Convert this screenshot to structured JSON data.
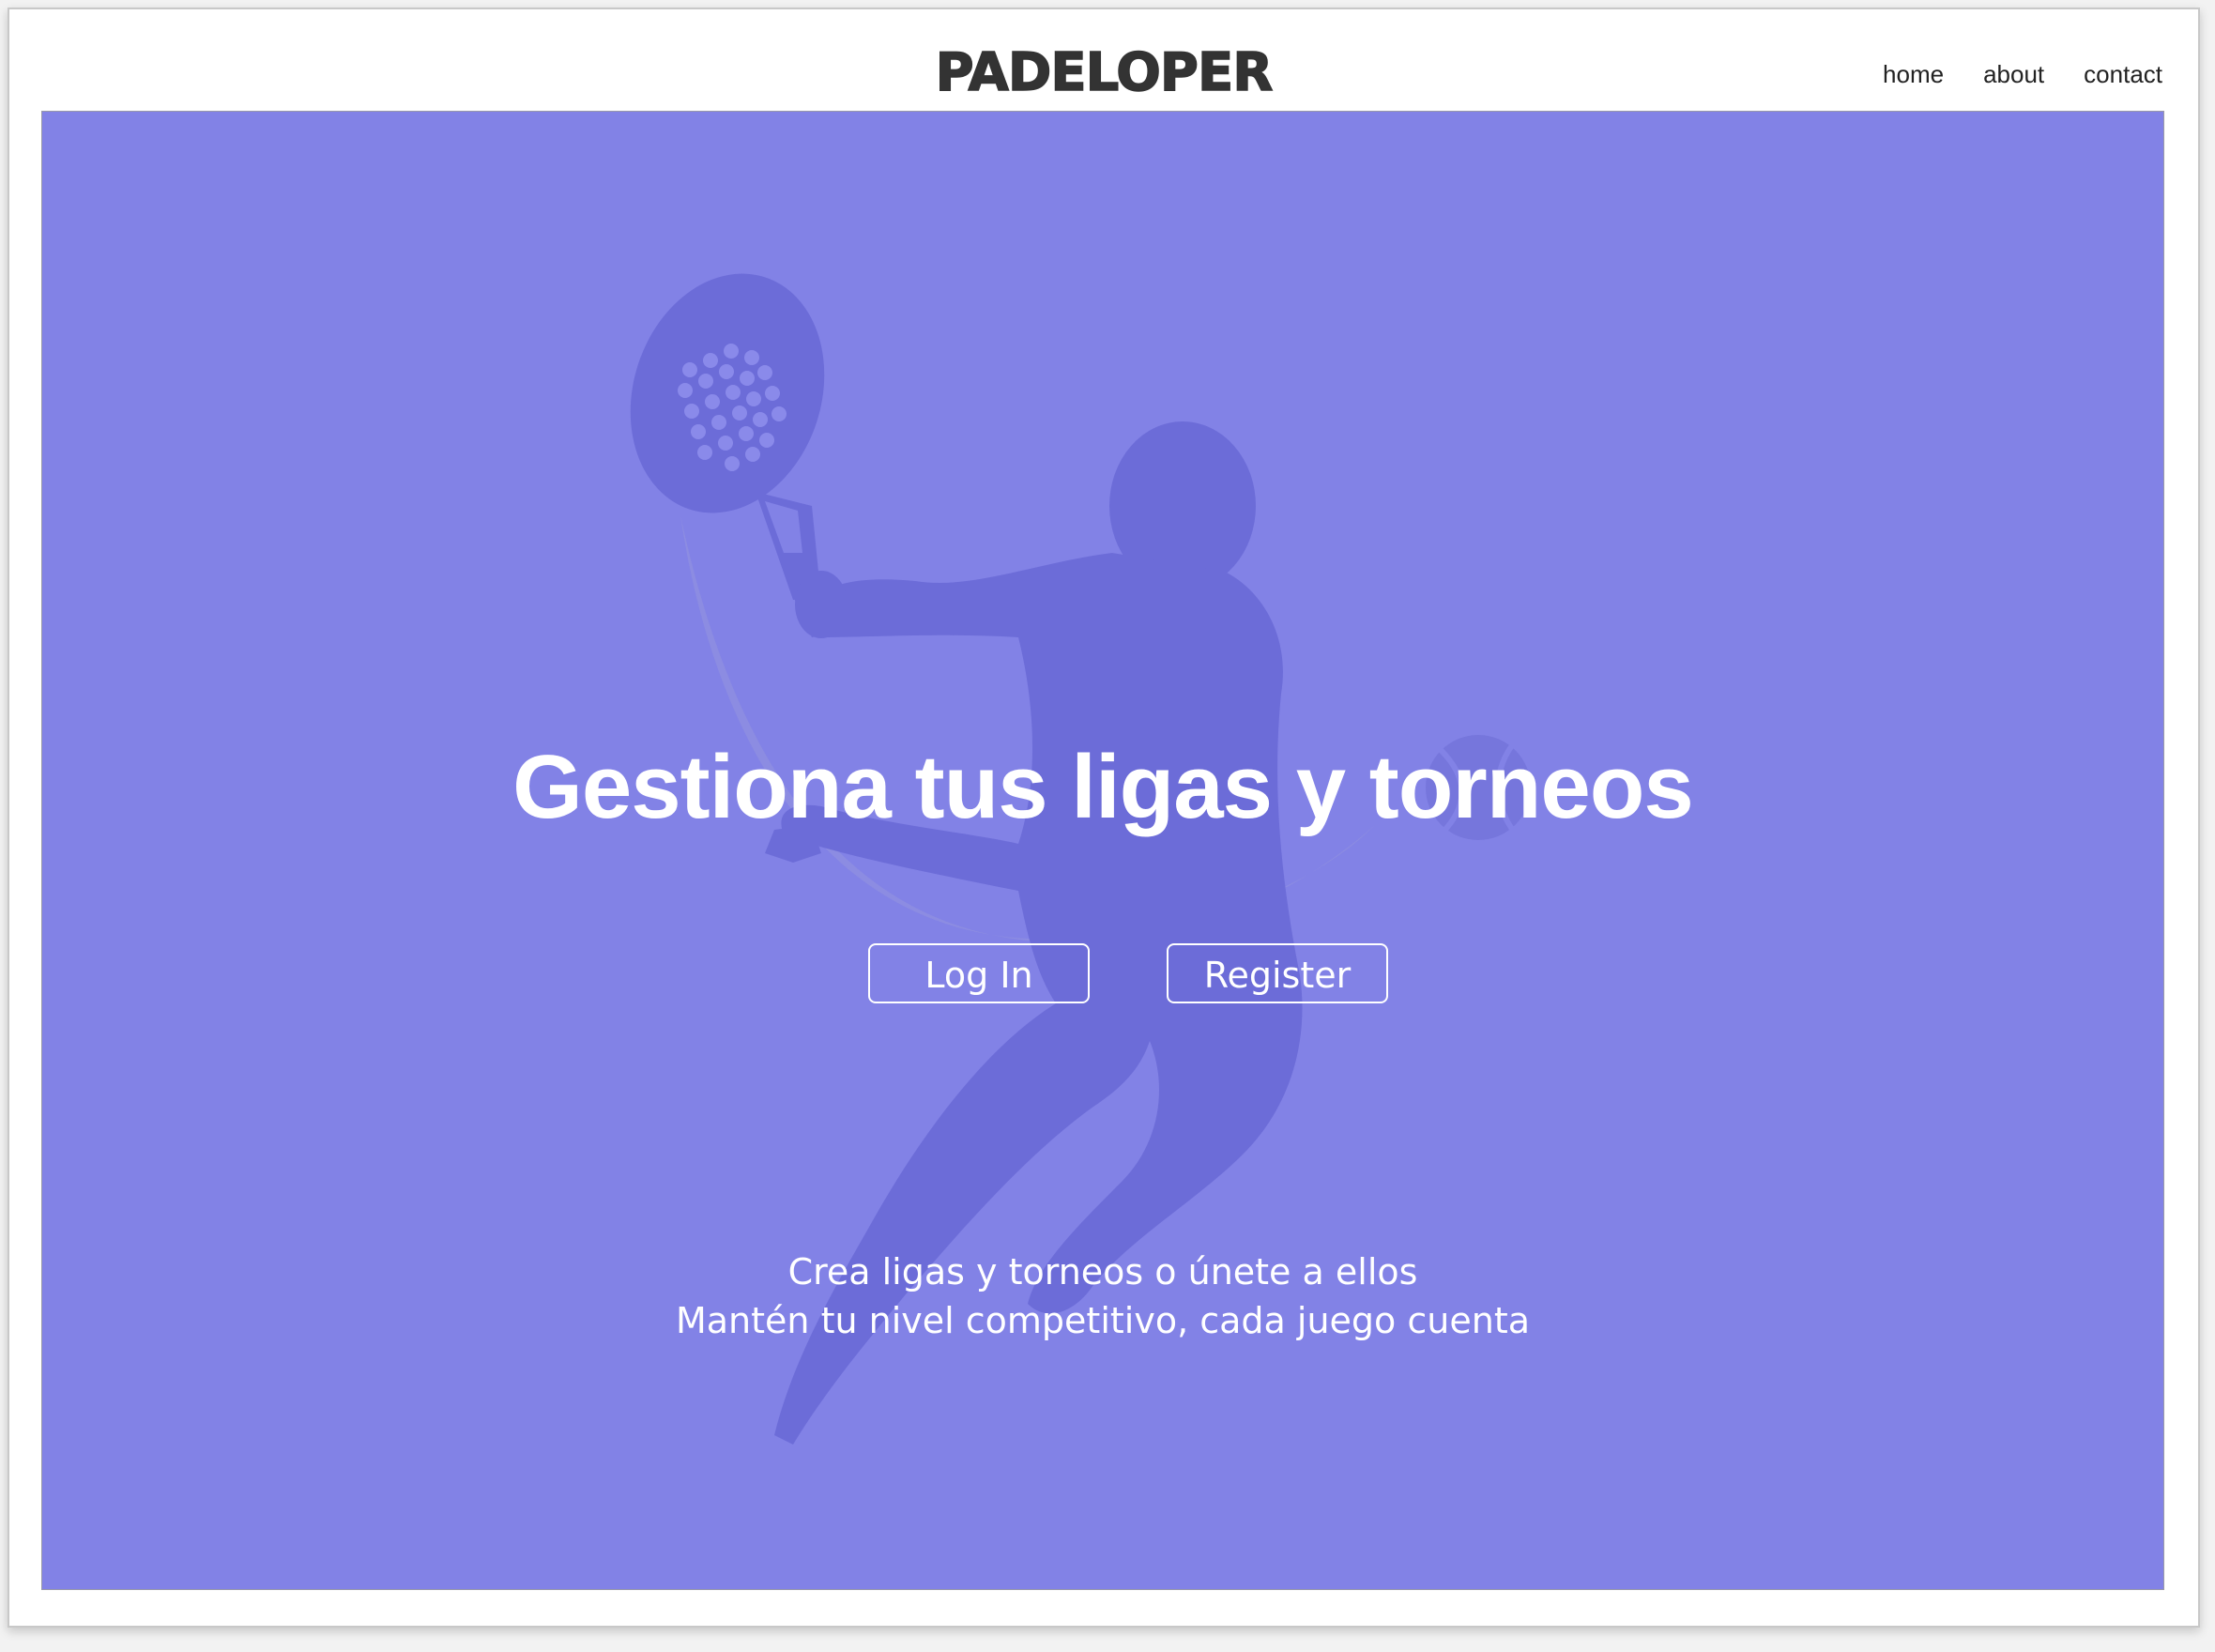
{
  "header": {
    "logo": "PADELOPER",
    "nav": [
      {
        "label": "home"
      },
      {
        "label": "about"
      },
      {
        "label": "contact"
      }
    ]
  },
  "hero": {
    "background_color": "#8282e6",
    "figure_color": "#6c6cd8",
    "title": "Gestiona tus ligas y torneos",
    "buttons": {
      "login": "Log In",
      "register": "Register"
    },
    "tagline": [
      "Crea ligas y torneos o únete a ellos",
      "Mantén tu nivel competitivo, cada juego cuenta"
    ]
  }
}
